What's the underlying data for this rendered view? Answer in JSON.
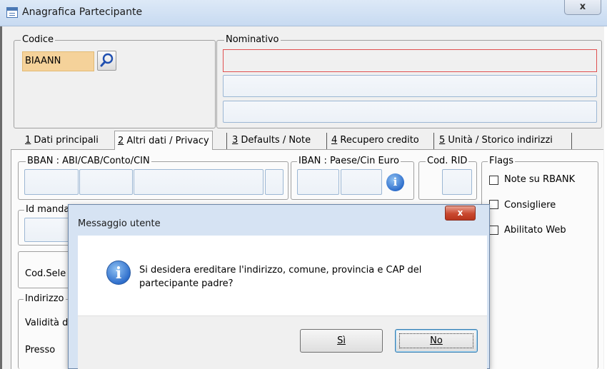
{
  "window": {
    "title": "Anagrafica Partecipante",
    "close_label": "x"
  },
  "codice": {
    "label": "Codice",
    "value": "BIAANN"
  },
  "nominativo": {
    "label": "Nominativo",
    "line1": "",
    "line2": "",
    "line3": ""
  },
  "tabs": [
    {
      "key": "1",
      "label": " Dati principali"
    },
    {
      "key": "2",
      "label": " Altri dati / Privacy"
    },
    {
      "key": "3",
      "label": " Defaults / Note"
    },
    {
      "key": "4",
      "label": " Recupero credito"
    },
    {
      "key": "5",
      "label": " Unità / Storico indirizzi"
    }
  ],
  "active_tab": 2,
  "bban": {
    "label": "BBAN : ABI/CAB/Conto/CIN"
  },
  "iban": {
    "label": "IBAN : Paese/Cin Euro"
  },
  "cod_rid": {
    "label": "Cod. RID"
  },
  "flags": {
    "label": "Flags",
    "items": [
      {
        "label": "Note su RBANK",
        "checked": false
      },
      {
        "label": "Consigliere",
        "checked": false
      },
      {
        "label": "Abilitato Web",
        "checked": false
      }
    ]
  },
  "id_mandato": {
    "label": "Id mandato RID / data mandato"
  },
  "cod_sele": {
    "label": "Cod.Sele"
  },
  "indirizzo": {
    "label": "Indirizzo"
  },
  "validita": {
    "label": "Validità d"
  },
  "presso": {
    "label": "Presso"
  },
  "dialog": {
    "title": "Messaggio utente",
    "close_label": "x",
    "message": "Si desidera ereditare l'indirizzo, comune, provincia e CAP del partecipante padre?",
    "yes_label": "Sì",
    "no_label": "No"
  },
  "colors": {
    "code_field_bg": "#f5d29a",
    "error_border": "#e05050",
    "dialog_close": "#c9482f",
    "info_icon": "#2f6fcc"
  },
  "icons": {
    "search": "search-icon",
    "info": "info-icon"
  }
}
